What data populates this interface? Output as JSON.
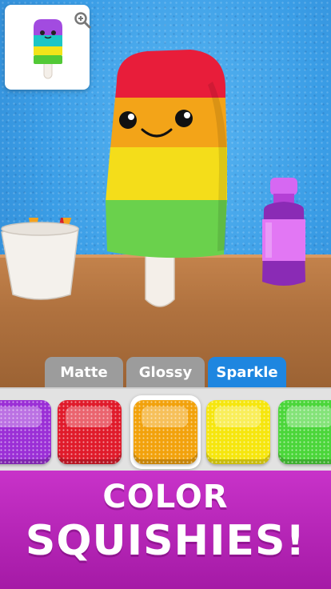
{
  "material_tabs": {
    "matte": "Matte",
    "glossy": "Glossy",
    "sparkle": "Sparkle",
    "selected": "Sparkle",
    "active_color": "#1e86e0",
    "inactive_color": "#9c9c9c"
  },
  "color_swatches": [
    {
      "name": "purple",
      "color": "#9b2fd6"
    },
    {
      "name": "red",
      "color": "#e01b2b"
    },
    {
      "name": "orange",
      "color": "#f2a20c"
    },
    {
      "name": "yellow",
      "color": "#f6e60e"
    },
    {
      "name": "green",
      "color": "#4bd63a"
    }
  ],
  "selected_swatch": "orange",
  "banner": {
    "line1": "COLOR",
    "line2": "SQUISHIES!",
    "color": "#b625b8"
  },
  "icons": {
    "zoom": "zoom-in-icon"
  }
}
